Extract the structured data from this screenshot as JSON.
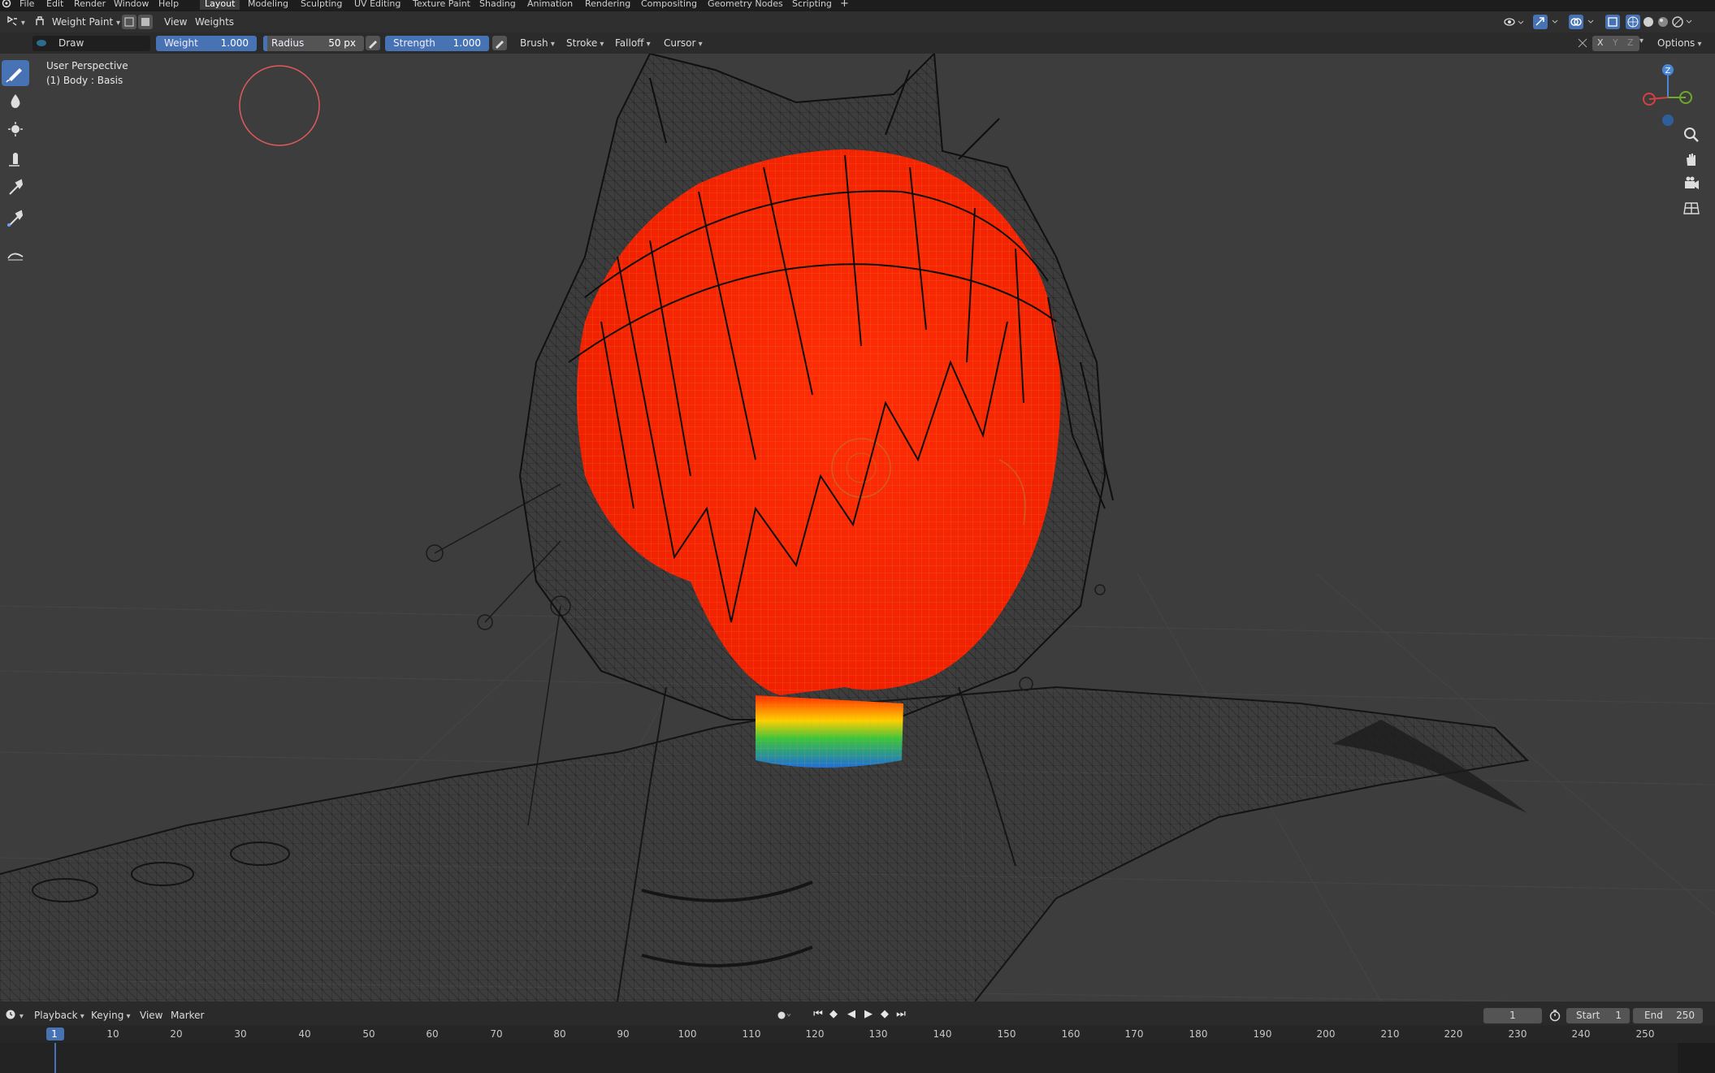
{
  "menubar": {
    "menus": [
      "File",
      "Edit",
      "Render",
      "Window",
      "Help"
    ],
    "workspaces": [
      {
        "label": "Layout",
        "active": true
      },
      {
        "label": "Modeling",
        "active": false
      },
      {
        "label": "Sculpting",
        "active": false
      },
      {
        "label": "UV Editing",
        "active": false
      },
      {
        "label": "Texture Paint",
        "active": false
      },
      {
        "label": "Shading",
        "active": false
      },
      {
        "label": "Animation",
        "active": false
      },
      {
        "label": "Rendering",
        "active": false
      },
      {
        "label": "Compositing",
        "active": false
      },
      {
        "label": "Geometry Nodes",
        "active": false
      },
      {
        "label": "Scripting",
        "active": false
      }
    ],
    "add_tab": "+"
  },
  "header": {
    "mode": "Weight Paint",
    "menus": [
      "View",
      "Weights"
    ]
  },
  "tool_settings": {
    "brush_name": "Draw",
    "weight": {
      "label": "Weight",
      "value": "1.000"
    },
    "radius": {
      "label": "Radius",
      "value": "50 px"
    },
    "strength": {
      "label": "Strength",
      "value": "1.000"
    },
    "dropdowns": [
      "Brush",
      "Stroke",
      "Falloff",
      "Cursor"
    ],
    "mirror_axes": [
      "X",
      "Y",
      "Z"
    ],
    "options_label": "Options"
  },
  "viewport": {
    "perspective_label": "User Perspective",
    "object_label": "(1) Body : Basis",
    "gizmo_axes": [
      "Z"
    ],
    "tools": [
      "draw-brush",
      "blur-brush",
      "average-brush",
      "smear-brush",
      "sample-weight",
      "sample-vertex-group",
      "gradient"
    ]
  },
  "timeline": {
    "menus": [
      "Playback",
      "Keying",
      "View",
      "Marker"
    ],
    "current_frame": "1",
    "start_label": "Start",
    "start_value": "1",
    "end_label": "End",
    "end_value": "250",
    "ruler_ticks": [
      "1",
      "10",
      "20",
      "30",
      "40",
      "50",
      "60",
      "70",
      "80",
      "90",
      "100",
      "110",
      "120",
      "130",
      "140",
      "150",
      "160",
      "170",
      "180",
      "190",
      "200",
      "210",
      "220",
      "230",
      "240",
      "250"
    ]
  },
  "colors": {
    "accent": "#4772b3",
    "weight_high": "#ff2a00",
    "weight_mid": "#3cc43c",
    "weight_low": "#1e6fd8"
  }
}
